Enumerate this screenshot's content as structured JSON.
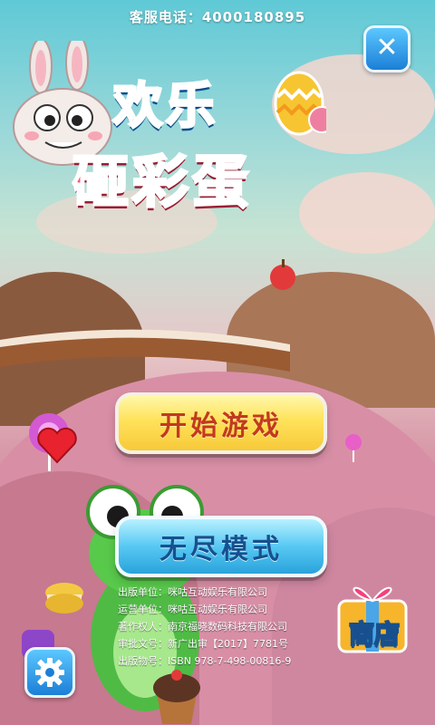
{
  "header": {
    "hotline": "客服电话：4000180895"
  },
  "logo": {
    "line1": "欢乐",
    "line2": "砸彩蛋"
  },
  "menu": {
    "start_label": "开始游戏",
    "endless_label": "无尽模式",
    "shop_label": "商店"
  },
  "credits": [
    "出版单位：咪咕互动娱乐有限公司",
    "运营单位：咪咕互动娱乐有限公司",
    "著作权人：南京福晓数码科技有限公司",
    "审批文号：新广出审【2017】7781号",
    "出版物号：ISBN 978-7-498-00816-9"
  ],
  "icons": {
    "close": "close-icon",
    "settings": "gear-icon",
    "shop": "gift-box-icon"
  },
  "colors": {
    "start_button": "#ffe25a",
    "endless_button": "#57c8f3",
    "title_blue": "#1f8be0",
    "title_red": "#ff4f6b"
  }
}
